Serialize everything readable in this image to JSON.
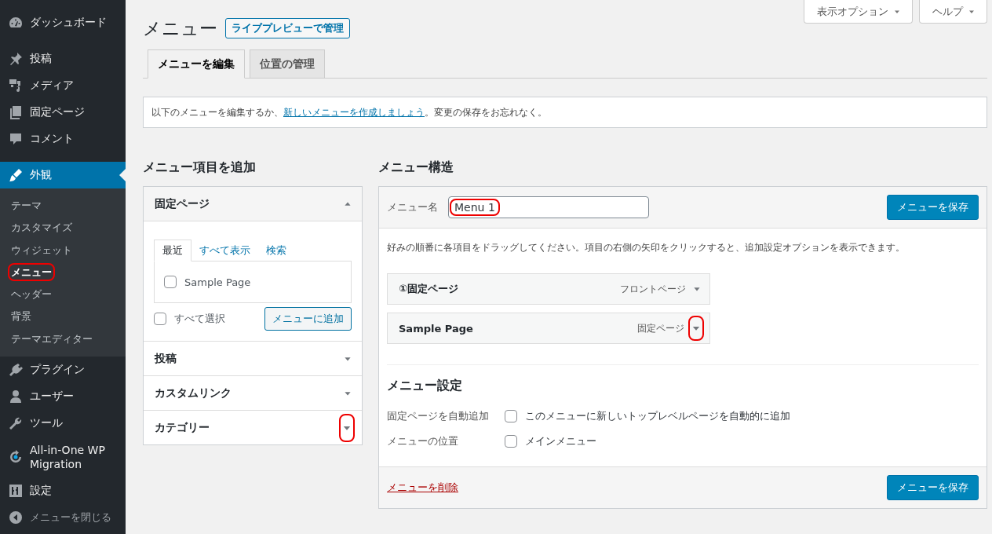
{
  "sidebar": {
    "items": [
      {
        "label": "ダッシュボード",
        "kind": "menu",
        "selected": false
      },
      {
        "label": "投稿",
        "kind": "menu",
        "selected": false
      },
      {
        "label": "メディア",
        "kind": "menu",
        "selected": false
      },
      {
        "label": "固定ページ",
        "kind": "menu",
        "selected": false
      },
      {
        "label": "コメント",
        "kind": "menu",
        "selected": false
      },
      {
        "label": "外観",
        "kind": "menu",
        "selected": true,
        "submenu": [
          {
            "label": "テーマ",
            "selected": false,
            "highlighted": false
          },
          {
            "label": "カスタマイズ",
            "selected": false,
            "highlighted": false
          },
          {
            "label": "ウィジェット",
            "selected": false,
            "highlighted": false
          },
          {
            "label": "メニュー",
            "selected": true,
            "highlighted": true
          },
          {
            "label": "ヘッダー",
            "selected": false,
            "highlighted": false
          },
          {
            "label": "背景",
            "selected": false,
            "highlighted": false
          },
          {
            "label": "テーマエディター",
            "selected": false,
            "highlighted": false
          }
        ]
      },
      {
        "label": "プラグイン",
        "kind": "menu",
        "selected": false
      },
      {
        "label": "ユーザー",
        "kind": "menu",
        "selected": false
      },
      {
        "label": "ツール",
        "kind": "menu",
        "selected": false
      },
      {
        "label": "All-in-One WP Migration",
        "kind": "menu",
        "selected": false
      },
      {
        "label": "設定",
        "kind": "menu",
        "selected": false
      },
      {
        "label": "メニューを閉じる",
        "kind": "collapse",
        "selected": false
      }
    ]
  },
  "header": {
    "screen_options": "表示オプション",
    "help": "ヘルプ",
    "title": "メニュー",
    "live_preview_button": "ライブプレビューで管理",
    "tabs": [
      {
        "label": "メニューを編集",
        "selected": true
      },
      {
        "label": "位置の管理",
        "selected": false
      }
    ],
    "notice": {
      "text_before": "以下のメニューを編集するか、",
      "link": "新しいメニューを作成しましょう",
      "text_after": "。変更の保存をお忘れなく。"
    }
  },
  "add_items": {
    "heading": "メニュー項目を追加",
    "sections": [
      {
        "title": "固定ページ",
        "expanded": true,
        "highlighted": false,
        "tabs": [
          {
            "label": "最近",
            "selected": true
          },
          {
            "label": "すべて表示",
            "selected": false
          },
          {
            "label": "検索",
            "selected": false
          }
        ],
        "items": [
          {
            "label": "Sample Page",
            "checked": false
          }
        ],
        "select_all": {
          "label": "すべて選択",
          "checked": false
        },
        "add_button": "メニューに追加"
      },
      {
        "title": "投稿",
        "expanded": false,
        "highlighted": false
      },
      {
        "title": "カスタムリンク",
        "expanded": false,
        "highlighted": false
      },
      {
        "title": "カテゴリー",
        "expanded": false,
        "highlighted": true
      }
    ]
  },
  "structure": {
    "heading": "メニュー構造",
    "menu_name_label": "メニュー名",
    "menu_name": {
      "value": "Menu 1",
      "highlighted": true
    },
    "save_button": "メニューを保存",
    "instructions": "好みの順番に各項目をドラッグしてください。項目の右側の矢印をクリックすると、追加設定オプションを表示できます。",
    "items": [
      {
        "title": "①固定ページ",
        "type": "フロントページ",
        "highlighted": false
      },
      {
        "title": "Sample Page",
        "type": "固定ページ",
        "highlighted": true
      }
    ],
    "settings": {
      "heading": "メニュー設定",
      "rows": [
        {
          "label": "固定ページを自動追加",
          "option": "このメニューに新しいトップレベルページを自動的に追加",
          "checked": false
        },
        {
          "label": "メニューの位置",
          "option": "メインメニュー",
          "checked": false
        }
      ]
    },
    "delete_link": "メニューを削除",
    "save_button_bottom": "メニューを保存"
  }
}
